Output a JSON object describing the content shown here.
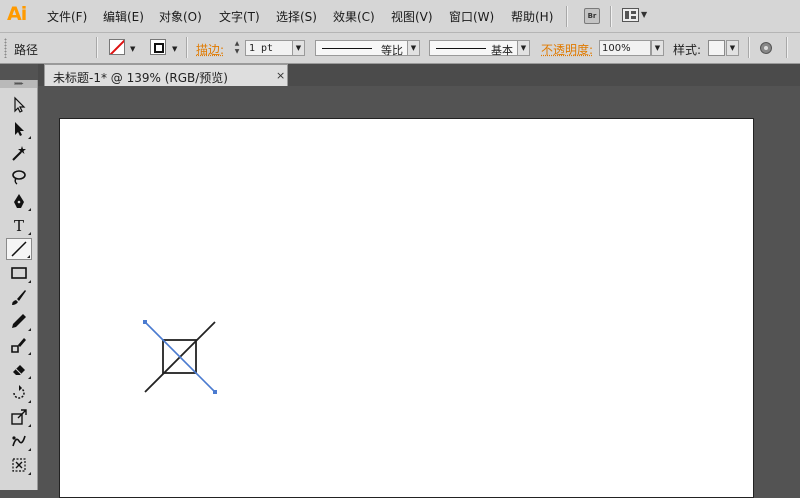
{
  "app": {
    "logo": "Ai"
  },
  "menu": {
    "items": [
      "文件(F)",
      "编辑(E)",
      "对象(O)",
      "文字(T)",
      "选择(S)",
      "效果(C)",
      "视图(V)",
      "窗口(W)",
      "帮助(H)"
    ],
    "bridge_button": "Br"
  },
  "controlbar": {
    "object_type": "路径",
    "stroke_label": "描边:",
    "stroke_weight": "1 pt",
    "variable_width_profile": "等比",
    "brush_definition": "基本",
    "opacity_label": "不透明度:",
    "opacity_value": "100%",
    "style_label": "样式:"
  },
  "document": {
    "tab_title": "未标题-1* @ 139% (RGB/预览)",
    "close_glyph": "×"
  },
  "tools": [
    {
      "name": "selection-tool-icon"
    },
    {
      "name": "direct-selection-tool-icon"
    },
    {
      "name": "magic-wand-tool-icon"
    },
    {
      "name": "lasso-tool-icon"
    },
    {
      "name": "pen-tool-icon"
    },
    {
      "name": "type-tool-icon",
      "glyph": "T"
    },
    {
      "name": "line-segment-tool-icon",
      "active": true
    },
    {
      "name": "rectangle-tool-icon"
    },
    {
      "name": "paintbrush-tool-icon"
    },
    {
      "name": "pencil-tool-icon"
    },
    {
      "name": "blob-brush-tool-icon"
    },
    {
      "name": "eraser-tool-icon"
    },
    {
      "name": "rotate-tool-icon"
    },
    {
      "name": "scale-tool-icon"
    },
    {
      "name": "puppet-warp-tool-icon"
    },
    {
      "name": "free-transform-tool-icon"
    }
  ],
  "colors": {
    "accent_label": "#e07a00",
    "selection": "#4a7bd0",
    "stroke": "#222222"
  }
}
